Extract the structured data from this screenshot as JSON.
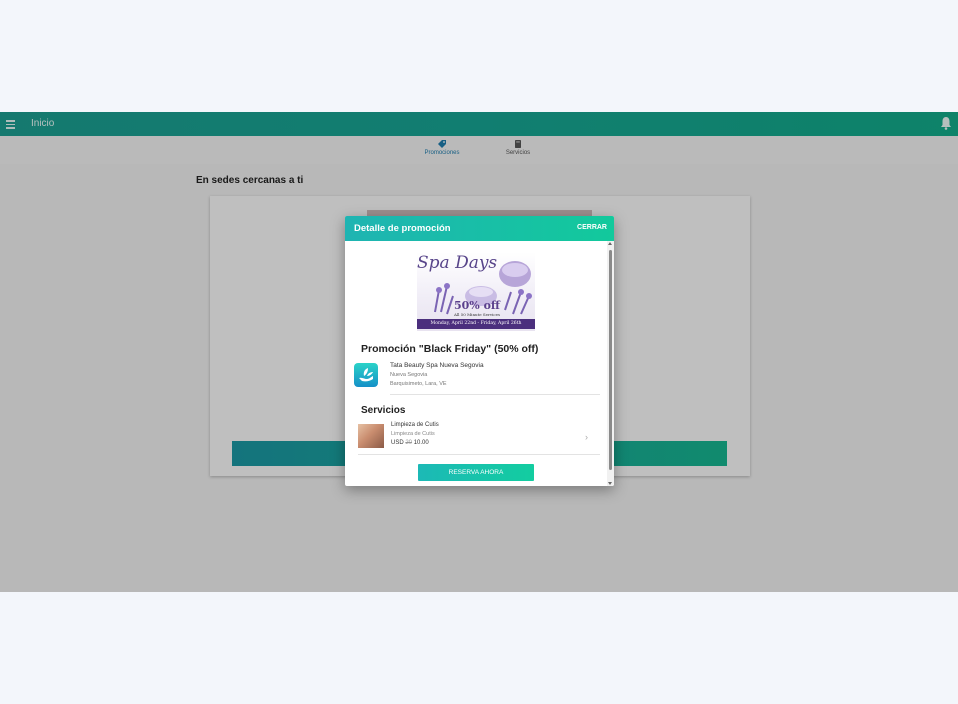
{
  "app": {
    "title": "Inicio",
    "accent": "#17a291"
  },
  "tabs": [
    {
      "label": "Promociones",
      "icon": "tag-icon",
      "active": true,
      "color": "#1e7aa9"
    },
    {
      "label": "Servicios",
      "icon": "book-icon",
      "active": false
    }
  ],
  "section": {
    "title": "En sedes cercanas a ti"
  },
  "modal": {
    "title": "Detalle de promoción",
    "close_label": "CERRAR",
    "promo_image": {
      "script": "Spa Days",
      "discount": "50% off",
      "subtitle": "All 50 Minute Services",
      "dates": "Monday, April 22nd - Friday, April 26th"
    },
    "promo_name": "Promoción \"Black Friday\" (50% off)",
    "spa": {
      "name": "Tata Beauty Spa Nueva Segovia",
      "area": "Nueva Segovia",
      "city": "Barquisimeto, Lara, VE",
      "logo_icon": "spa-hand-leaf-icon"
    },
    "services_title": "Servicios",
    "service": {
      "name": "Limpieza de Cutis",
      "subtitle": "Limpieza de Cutis",
      "currency": "USD",
      "old_price": "20",
      "price": "10.00"
    },
    "book_label": "RESERVA AHORA"
  }
}
